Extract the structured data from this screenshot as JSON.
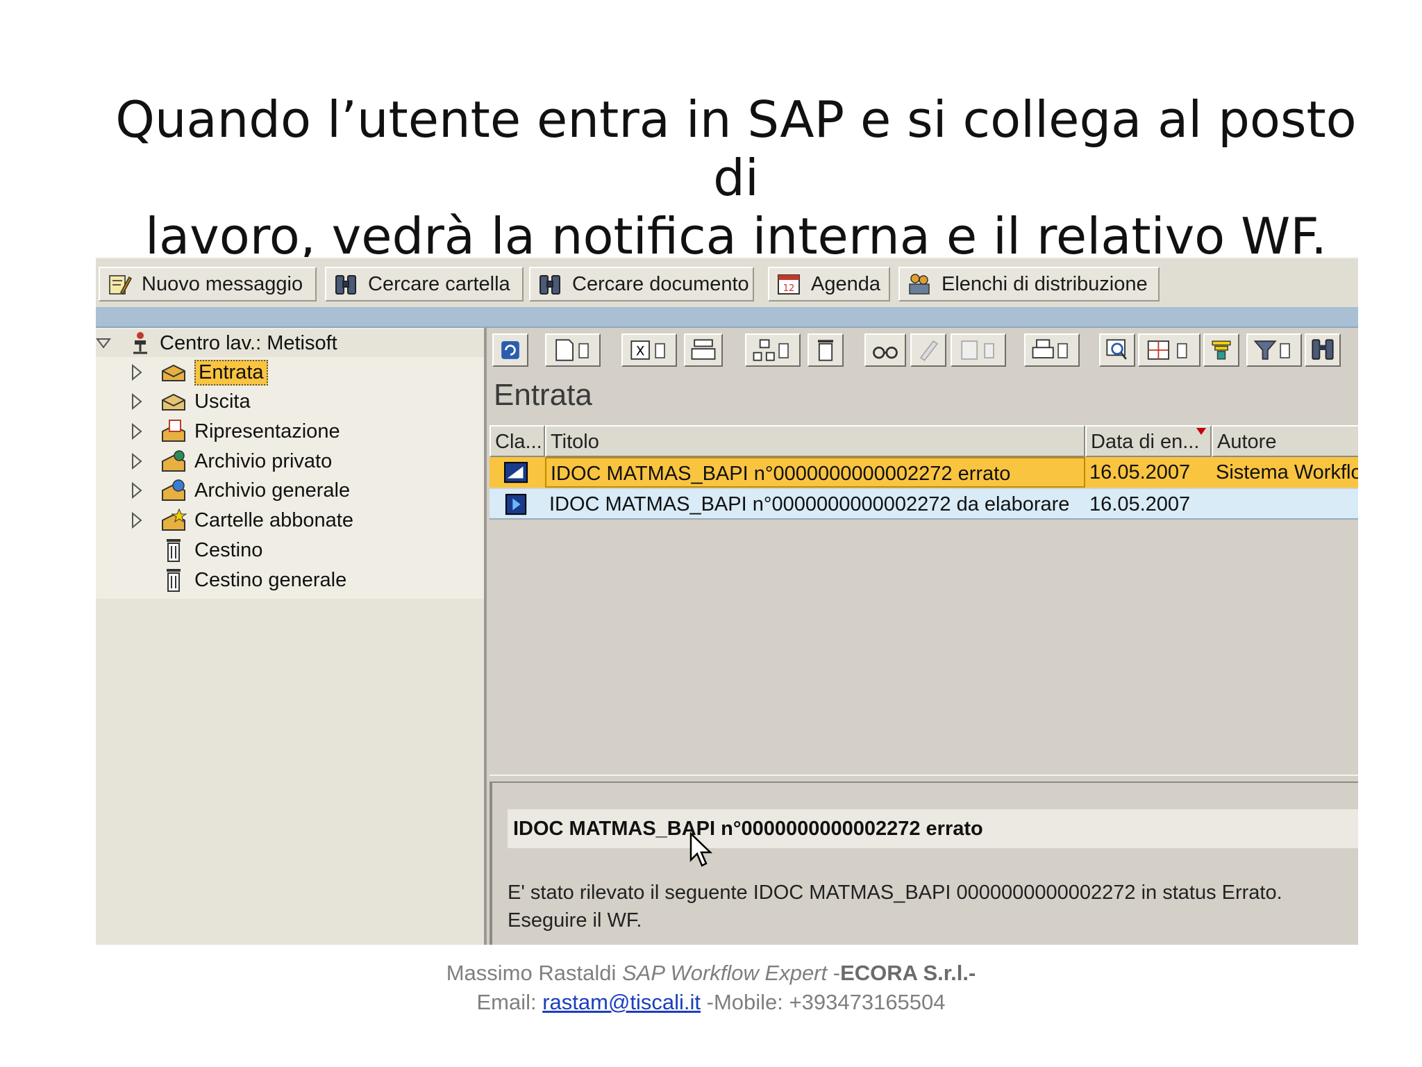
{
  "slide": {
    "title_line1": "Quando l’utente entra in SAP e si collega al posto di",
    "title_line2": "lavoro, vedrà la notifica interna e il relativo WF."
  },
  "toolbar": {
    "new_message": "Nuovo messaggio",
    "search_folder": "Cercare cartella",
    "search_document": "Cercare documento",
    "agenda": "Agenda",
    "distribution_lists": "Elenchi di distribuzione"
  },
  "tree": {
    "root": "Centro lav.: Metisoft",
    "items": [
      {
        "label": "Entrata",
        "icon": "inbox-icon",
        "expandable": true
      },
      {
        "label": "Uscita",
        "icon": "outbox-icon",
        "expandable": true
      },
      {
        "label": "Ripresentazione",
        "icon": "calendar-icon",
        "expandable": true
      },
      {
        "label": "Archivio privato",
        "icon": "private-archive-icon",
        "expandable": true
      },
      {
        "label": "Archivio generale",
        "icon": "general-archive-icon",
        "expandable": true
      },
      {
        "label": "Cartelle abbonate",
        "icon": "subscribed-folders-icon",
        "expandable": true
      },
      {
        "label": "Cestino",
        "icon": "trash-icon",
        "expandable": false
      },
      {
        "label": "Cestino generale",
        "icon": "trash-icon",
        "expandable": false
      }
    ]
  },
  "pane": {
    "title": "Entrata",
    "columns": [
      "Cla...",
      "Titolo",
      "Data di en...",
      "Autore"
    ],
    "rows": [
      {
        "title": "IDOC MATMAS_BAPI n°0000000000002272 errato",
        "date": "16.05.2007",
        "author": "Sistema Workflo",
        "selected": true
      },
      {
        "title": "IDOC MATMAS_BAPI n°0000000000002272 da elaborare",
        "date": "16.05.2007",
        "author": "",
        "selected": false
      }
    ]
  },
  "preview": {
    "subject": "IDOC MATMAS_BAPI n°0000000000002272 errato",
    "body_line1": "E' stato rilevato il seguente IDOC MATMAS_BAPI  0000000000002272 in status Errato.",
    "body_line2": "Eseguire il WF."
  },
  "footer": {
    "name": "Massimo Rastaldi",
    "role": "SAP Workflow Expert",
    "company_prefix": " -",
    "company": "ECORA S.r.l.-",
    "email_label": "Email: ",
    "email": "rastam@tiscali.it",
    "mobile": " -Mobile: +393473165504"
  },
  "colors": {
    "selection": "#f9c440",
    "band": "#a9bfd3",
    "row_alt": "#d8ebf7",
    "background": "#d4d0c8"
  }
}
